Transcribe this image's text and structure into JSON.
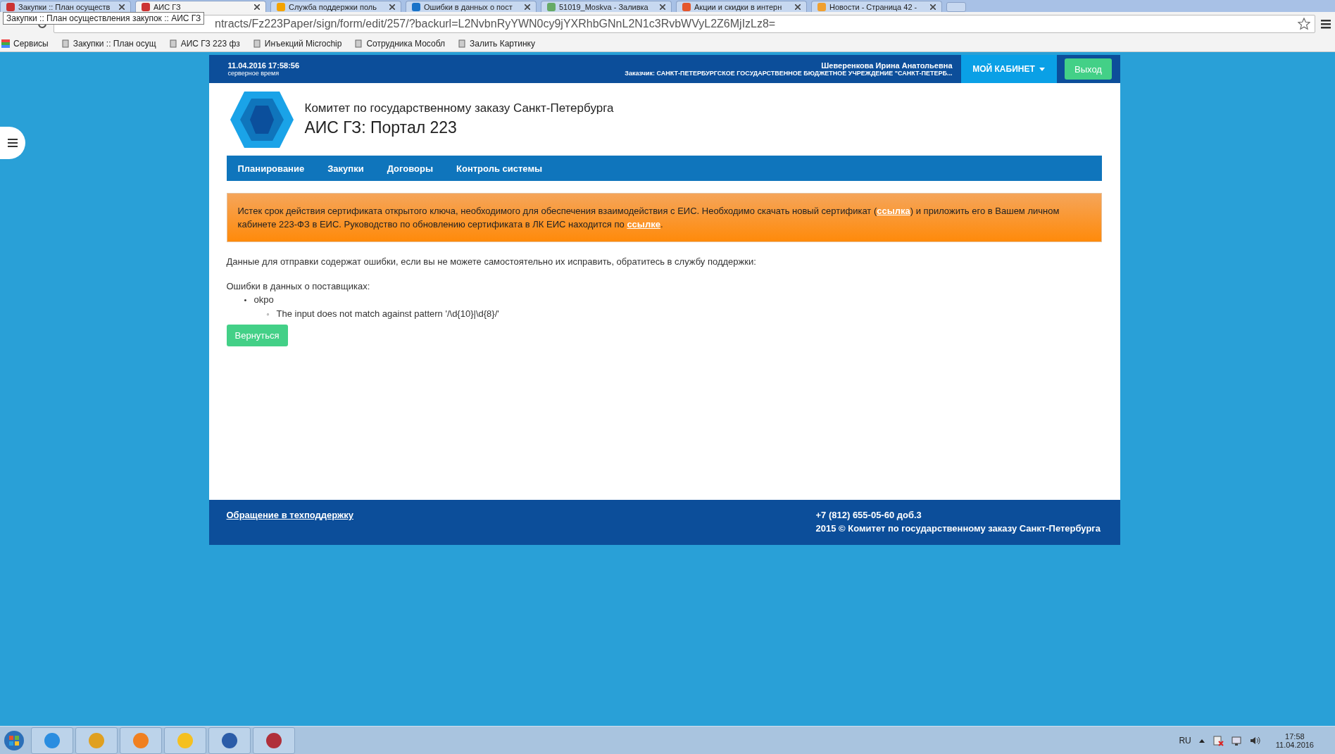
{
  "browser": {
    "tabs": [
      {
        "label": "Закупки :: План осуществ",
        "selected": false
      },
      {
        "label": "АИС ГЗ",
        "selected": true
      },
      {
        "label": "Служба поддержки поль",
        "selected": false
      },
      {
        "label": "Ошибки в данных о пост",
        "selected": false
      },
      {
        "label": "51019_Moskva - Заливка",
        "selected": false
      },
      {
        "label": "Акции и скидки в интерн",
        "selected": false
      },
      {
        "label": "Новости - Страница 42 -",
        "selected": false
      }
    ],
    "tooltip": "Закупки :: План осуществления закупок :: АИС ГЗ",
    "url": "ntracts/Fz223Paper/sign/form/edit/257/?backurl=L2NvbnRyYWN0cy9jYXRhbGNnL2N1c3RvbWVyL2Z6MjIzLz8=",
    "bookmarks": [
      {
        "label": "Сервисы"
      },
      {
        "label": "Закупки :: План осущ"
      },
      {
        "label": "АИС ГЗ 223 фз"
      },
      {
        "label": "Инъекций Microchip"
      },
      {
        "label": "Сотрудника Мособл"
      },
      {
        "label": "Залить Картинку"
      }
    ]
  },
  "top_bar": {
    "datetime": "11.04.2016 17:58:56",
    "datetime_note": "серверное время",
    "user_name": "Шеверенкова Ирина Анатольевна",
    "customer": "Заказчик: САНКТ-ПЕТЕРБУРГСКОЕ ГОСУДАРСТВЕННОЕ БЮДЖЕТНОЕ УЧРЕЖДЕНИЕ \"САНКТ-ПЕТЕРБ...",
    "cabinet_button": "МОЙ КАБИНЕТ",
    "logout_button": "Выход"
  },
  "header": {
    "org_name": "Комитет по государственному заказу Санкт-Петербурга",
    "portal_title": "АИС ГЗ: Портал 223"
  },
  "nav": [
    {
      "label": "Планирование"
    },
    {
      "label": "Закупки"
    },
    {
      "label": "Договоры"
    },
    {
      "label": "Контроль системы"
    }
  ],
  "alert": [
    {
      "kind": "text",
      "text": "Истек срок действия сертификата открытого ключа, необходимого для обеспечения взаимодействия с ЕИС. Необходимо скачать новый сертификат ("
    },
    {
      "kind": "link",
      "text": "ссылка"
    },
    {
      "kind": "text",
      "text": ") и приложить его в Вашем личном кабинете 223-ФЗ в ЕИС. Руководство по обновлению сертификата в ЛК ЕИС находится по "
    },
    {
      "kind": "link",
      "text": "ссылке"
    },
    {
      "kind": "text",
      "text": "."
    }
  ],
  "message": "Данные для отправки содержат ошибки, если вы не можете самостоятельно их исправить, обратитесь в службу поддержки:",
  "errors": {
    "heading": "Ошибки в данных о поставщиках:",
    "items": [
      {
        "marker": "•",
        "label": "okpo",
        "children": [
          {
            "marker": "◦",
            "label": "The input does not match against pattern '/\\d{10}|\\d{8}/'"
          }
        ]
      }
    ]
  },
  "back_button": "Вернуться",
  "footer": {
    "support_link": "Обращение в техподдержку",
    "phone": "+7 (812) 655-05-60 доб.3",
    "copyright": "2015 © Комитет по государственному заказу Санкт-Петербурга"
  },
  "taskbar": {
    "language": "RU",
    "time": "17:58",
    "date": "11.04.2016"
  }
}
